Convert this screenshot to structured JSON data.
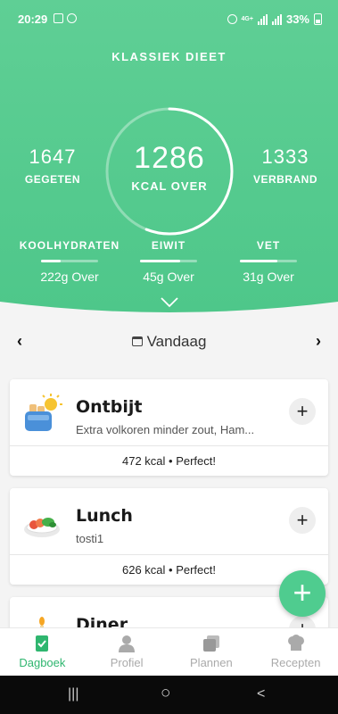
{
  "status_bar": {
    "time": "20:29",
    "battery": "33%",
    "signal_label": "4G+"
  },
  "header": {
    "diet_title": "KLASSIEK DIEET",
    "calories_remaining": "1286",
    "calories_remaining_label": "KCAL OVER",
    "eaten_value": "1647",
    "eaten_label": "GEGETEN",
    "burned_value": "1333",
    "burned_label": "VERBRAND",
    "ring_progress": 0.56,
    "macros": [
      {
        "name": "KOOLHYDRATEN",
        "value": "222g Over",
        "progress": 0.35
      },
      {
        "name": "EIWIT",
        "value": "45g Over",
        "progress": 0.7
      },
      {
        "name": "VET",
        "value": "31g Over",
        "progress": 0.65
      }
    ],
    "colors": {
      "green_top": "#5fcf95",
      "green_bottom": "#4fc88b"
    }
  },
  "date_nav": {
    "prev": "‹",
    "next": "›",
    "label": "Vandaag"
  },
  "meals": [
    {
      "name": "Ontbijt",
      "description": "Extra volkoren minder zout, Ham...",
      "footer": "472 kcal • Perfect!",
      "add": "+"
    },
    {
      "name": "Lunch",
      "description": "tosti1",
      "footer": "626 kcal • Perfect!",
      "add": "+"
    },
    {
      "name": "Diner",
      "description": "",
      "footer": "",
      "add": "+"
    }
  ],
  "fab": {
    "label": "+"
  },
  "tabs": [
    {
      "label": "Dagboek",
      "icon": "diary-icon",
      "active": true
    },
    {
      "label": "Profiel",
      "icon": "person-icon",
      "active": false
    },
    {
      "label": "Plannen",
      "icon": "plans-icon",
      "active": false
    },
    {
      "label": "Recepten",
      "icon": "chef-hat-icon",
      "active": false
    }
  ],
  "system_nav": {
    "recents": "|||",
    "home": "○",
    "back": "<"
  }
}
